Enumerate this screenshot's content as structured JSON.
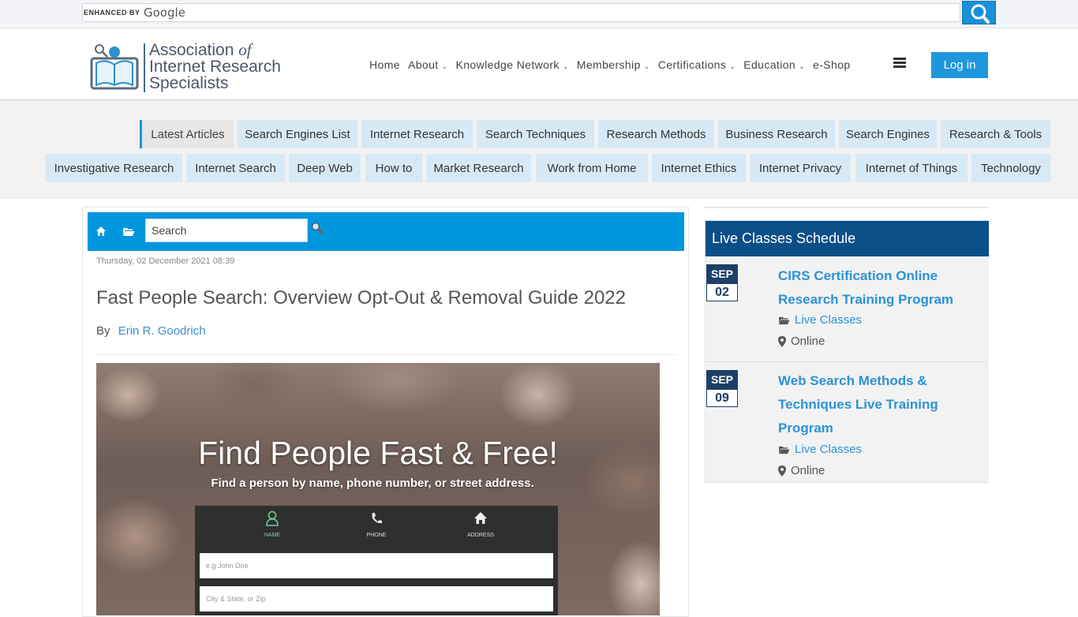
{
  "google_bar": {
    "enhanced_by": "ENHANCED BY",
    "google": "Google"
  },
  "logo": {
    "line1": "Association",
    "line1_of": "of",
    "line2": "Internet Research",
    "line3": "Specialists"
  },
  "nav": {
    "items": [
      {
        "label": "Home",
        "dropdown": false
      },
      {
        "label": "About",
        "dropdown": true
      },
      {
        "label": "Knowledge Network",
        "dropdown": true
      },
      {
        "label": "Membership",
        "dropdown": true
      },
      {
        "label": "Certifications",
        "dropdown": true
      },
      {
        "label": "Education",
        "dropdown": true
      },
      {
        "label": "e-Shop",
        "dropdown": false
      }
    ],
    "login": "Log in"
  },
  "categories": {
    "row1": [
      "Latest Articles",
      "Search Engines List",
      "Internet Research",
      "Search Techniques",
      "Research Methods",
      "Business Research",
      "Search Engines",
      "Research & Tools"
    ],
    "row2": [
      "Investigative Research",
      "Internet Search",
      "Deep Web",
      "How to",
      "Market Research",
      "Work from Home",
      "Internet Ethics",
      "Internet Privacy",
      "Internet of Things",
      "Technology"
    ]
  },
  "article": {
    "search_placeholder": "Search",
    "date": "Thursday, 02 December 2021 08:39",
    "title": "Fast People Search: Overview Opt-Out & Removal Guide 2022",
    "by": "By",
    "author": "Erin R. Goodrich",
    "hero": {
      "headline": "Find People Fast & Free!",
      "subhead": "Find a person by name, phone number, or street address.",
      "tabs": [
        "NAME",
        "PHONE",
        "ADDRESS"
      ],
      "field1": "e.g John Doe",
      "field2": "City & State, or Zip"
    }
  },
  "sidebar": {
    "heading": "Live Classes Schedule",
    "events": [
      {
        "month": "SEP",
        "day": "02",
        "title": "CIRS Certification Online Research Training Program",
        "category": "Live Classes",
        "location": "Online"
      },
      {
        "month": "SEP",
        "day": "09",
        "title": "Web Search Methods & Techniques Live Training Program",
        "category": "Live Classes",
        "location": "Online"
      }
    ]
  },
  "colors": {
    "primary_blue": "#0096de",
    "sidebar_head": "#0b4f89",
    "tag_bg": "#d8e9f6",
    "link": "#2b93d6"
  }
}
